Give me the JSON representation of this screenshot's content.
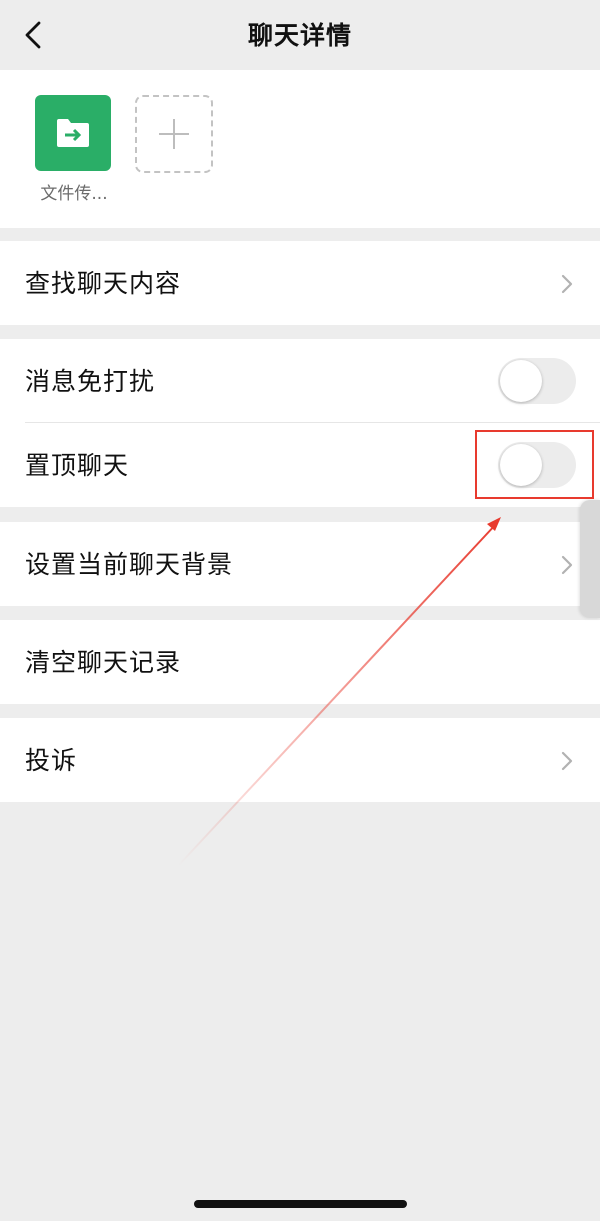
{
  "navbar": {
    "title": "聊天详情",
    "back_icon": "chevron-left-icon"
  },
  "members": {
    "items": [
      {
        "name": "文件传...",
        "icon": "file-transfer-icon",
        "color": "#2aae67"
      }
    ],
    "add_icon": "plus-icon"
  },
  "settings": {
    "search_chat_content": "查找聊天内容",
    "mute_notifications": {
      "label": "消息免打扰",
      "on": false
    },
    "sticky_on_top": {
      "label": "置顶聊天",
      "on": false
    },
    "set_chat_background": "设置当前聊天背景",
    "clear_chat_history": "清空聊天记录",
    "report": "投诉"
  },
  "colors": {
    "background": "#ededed",
    "switch_off": "#ececec",
    "annotation": "#e83a2e",
    "brand_green": "#2aae67"
  }
}
